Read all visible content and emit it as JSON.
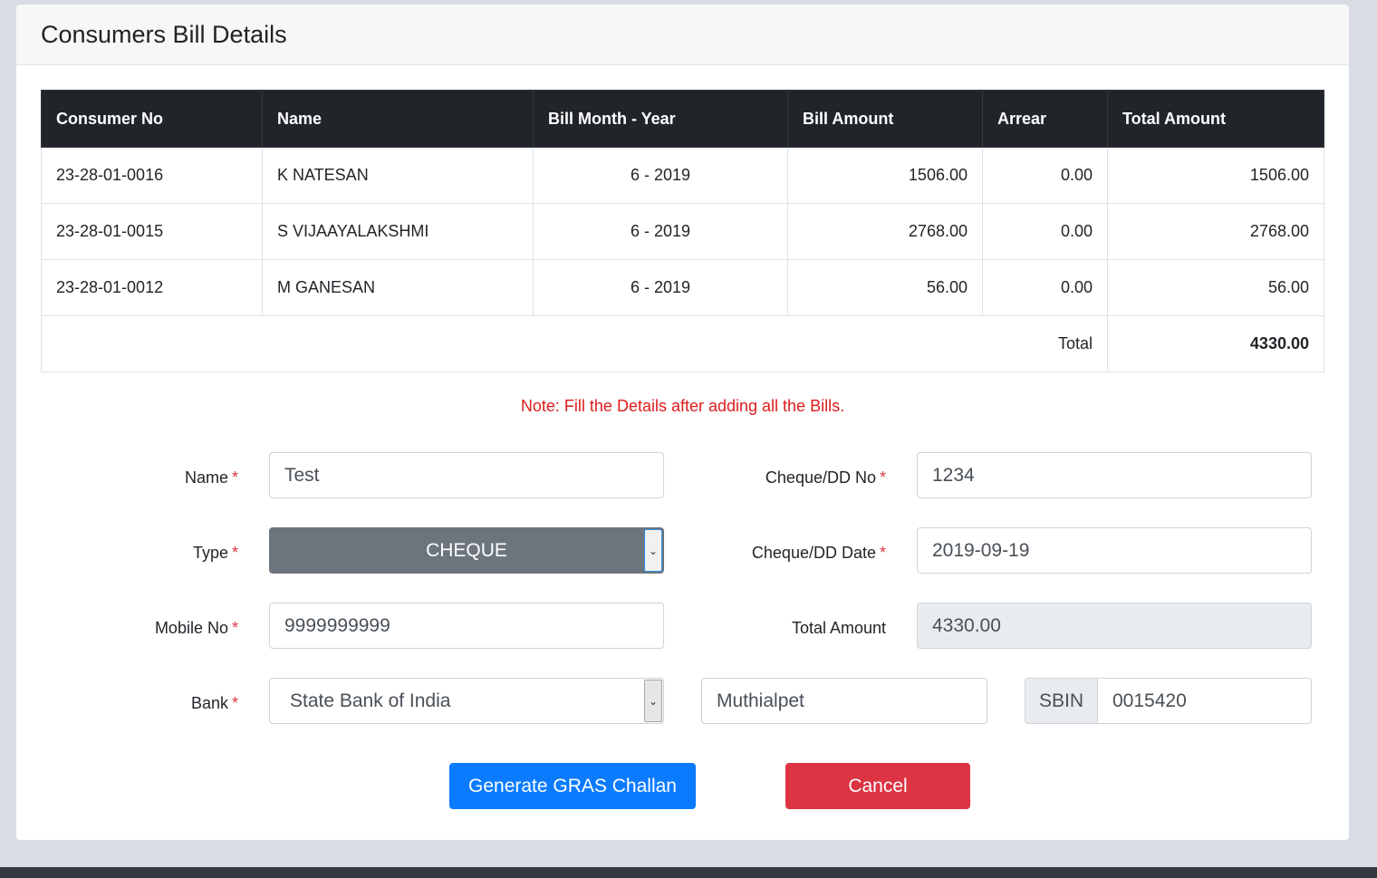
{
  "header": {
    "title": "Consumers Bill Details"
  },
  "table": {
    "columns": [
      "Consumer No",
      "Name",
      "Bill Month - Year",
      "Bill Amount",
      "Arrear",
      "Total Amount"
    ],
    "rows": [
      {
        "consumer_no": "23-28-01-0016",
        "name": "K NATESAN",
        "month_year": "6 - 2019",
        "bill_amount": "1506.00",
        "arrear": "0.00",
        "total": "1506.00"
      },
      {
        "consumer_no": "23-28-01-0015",
        "name": "S VIJAAYALAKSHMI",
        "month_year": "6 - 2019",
        "bill_amount": "2768.00",
        "arrear": "0.00",
        "total": "2768.00"
      },
      {
        "consumer_no": "23-28-01-0012",
        "name": "M GANESAN",
        "month_year": "6 - 2019",
        "bill_amount": "56.00",
        "arrear": "0.00",
        "total": "56.00"
      }
    ],
    "total_label": "Total",
    "total_value": "4330.00"
  },
  "note": "Note: Fill the Details after adding all the Bills.",
  "form": {
    "required_marker": "*",
    "name": {
      "label": "Name",
      "value": "Test"
    },
    "type": {
      "label": "Type",
      "value": "CHEQUE",
      "arrow": "chevron-down-icon"
    },
    "mobile": {
      "label": "Mobile No",
      "value": "9999999999"
    },
    "bank": {
      "label": "Bank",
      "value": "State Bank of India",
      "arrow": "chevron-down-icon"
    },
    "branch": {
      "value": "Muthialpet"
    },
    "ifsc": {
      "prefix": "SBIN",
      "value": "0015420"
    },
    "cheque_no": {
      "label": "Cheque/DD No",
      "value": "1234"
    },
    "cheque_date": {
      "label": "Cheque/DD Date",
      "value": "2019-09-19"
    },
    "total_amount": {
      "label": "Total Amount",
      "value": "4330.00"
    }
  },
  "buttons": {
    "generate": "Generate GRAS Challan",
    "cancel": "Cancel"
  },
  "colors": {
    "table_header_bg": "#212529",
    "note_red": "#dc1c1c",
    "primary": "#0a7bff",
    "danger": "#dd3444",
    "select_gray": "#6c757d"
  }
}
